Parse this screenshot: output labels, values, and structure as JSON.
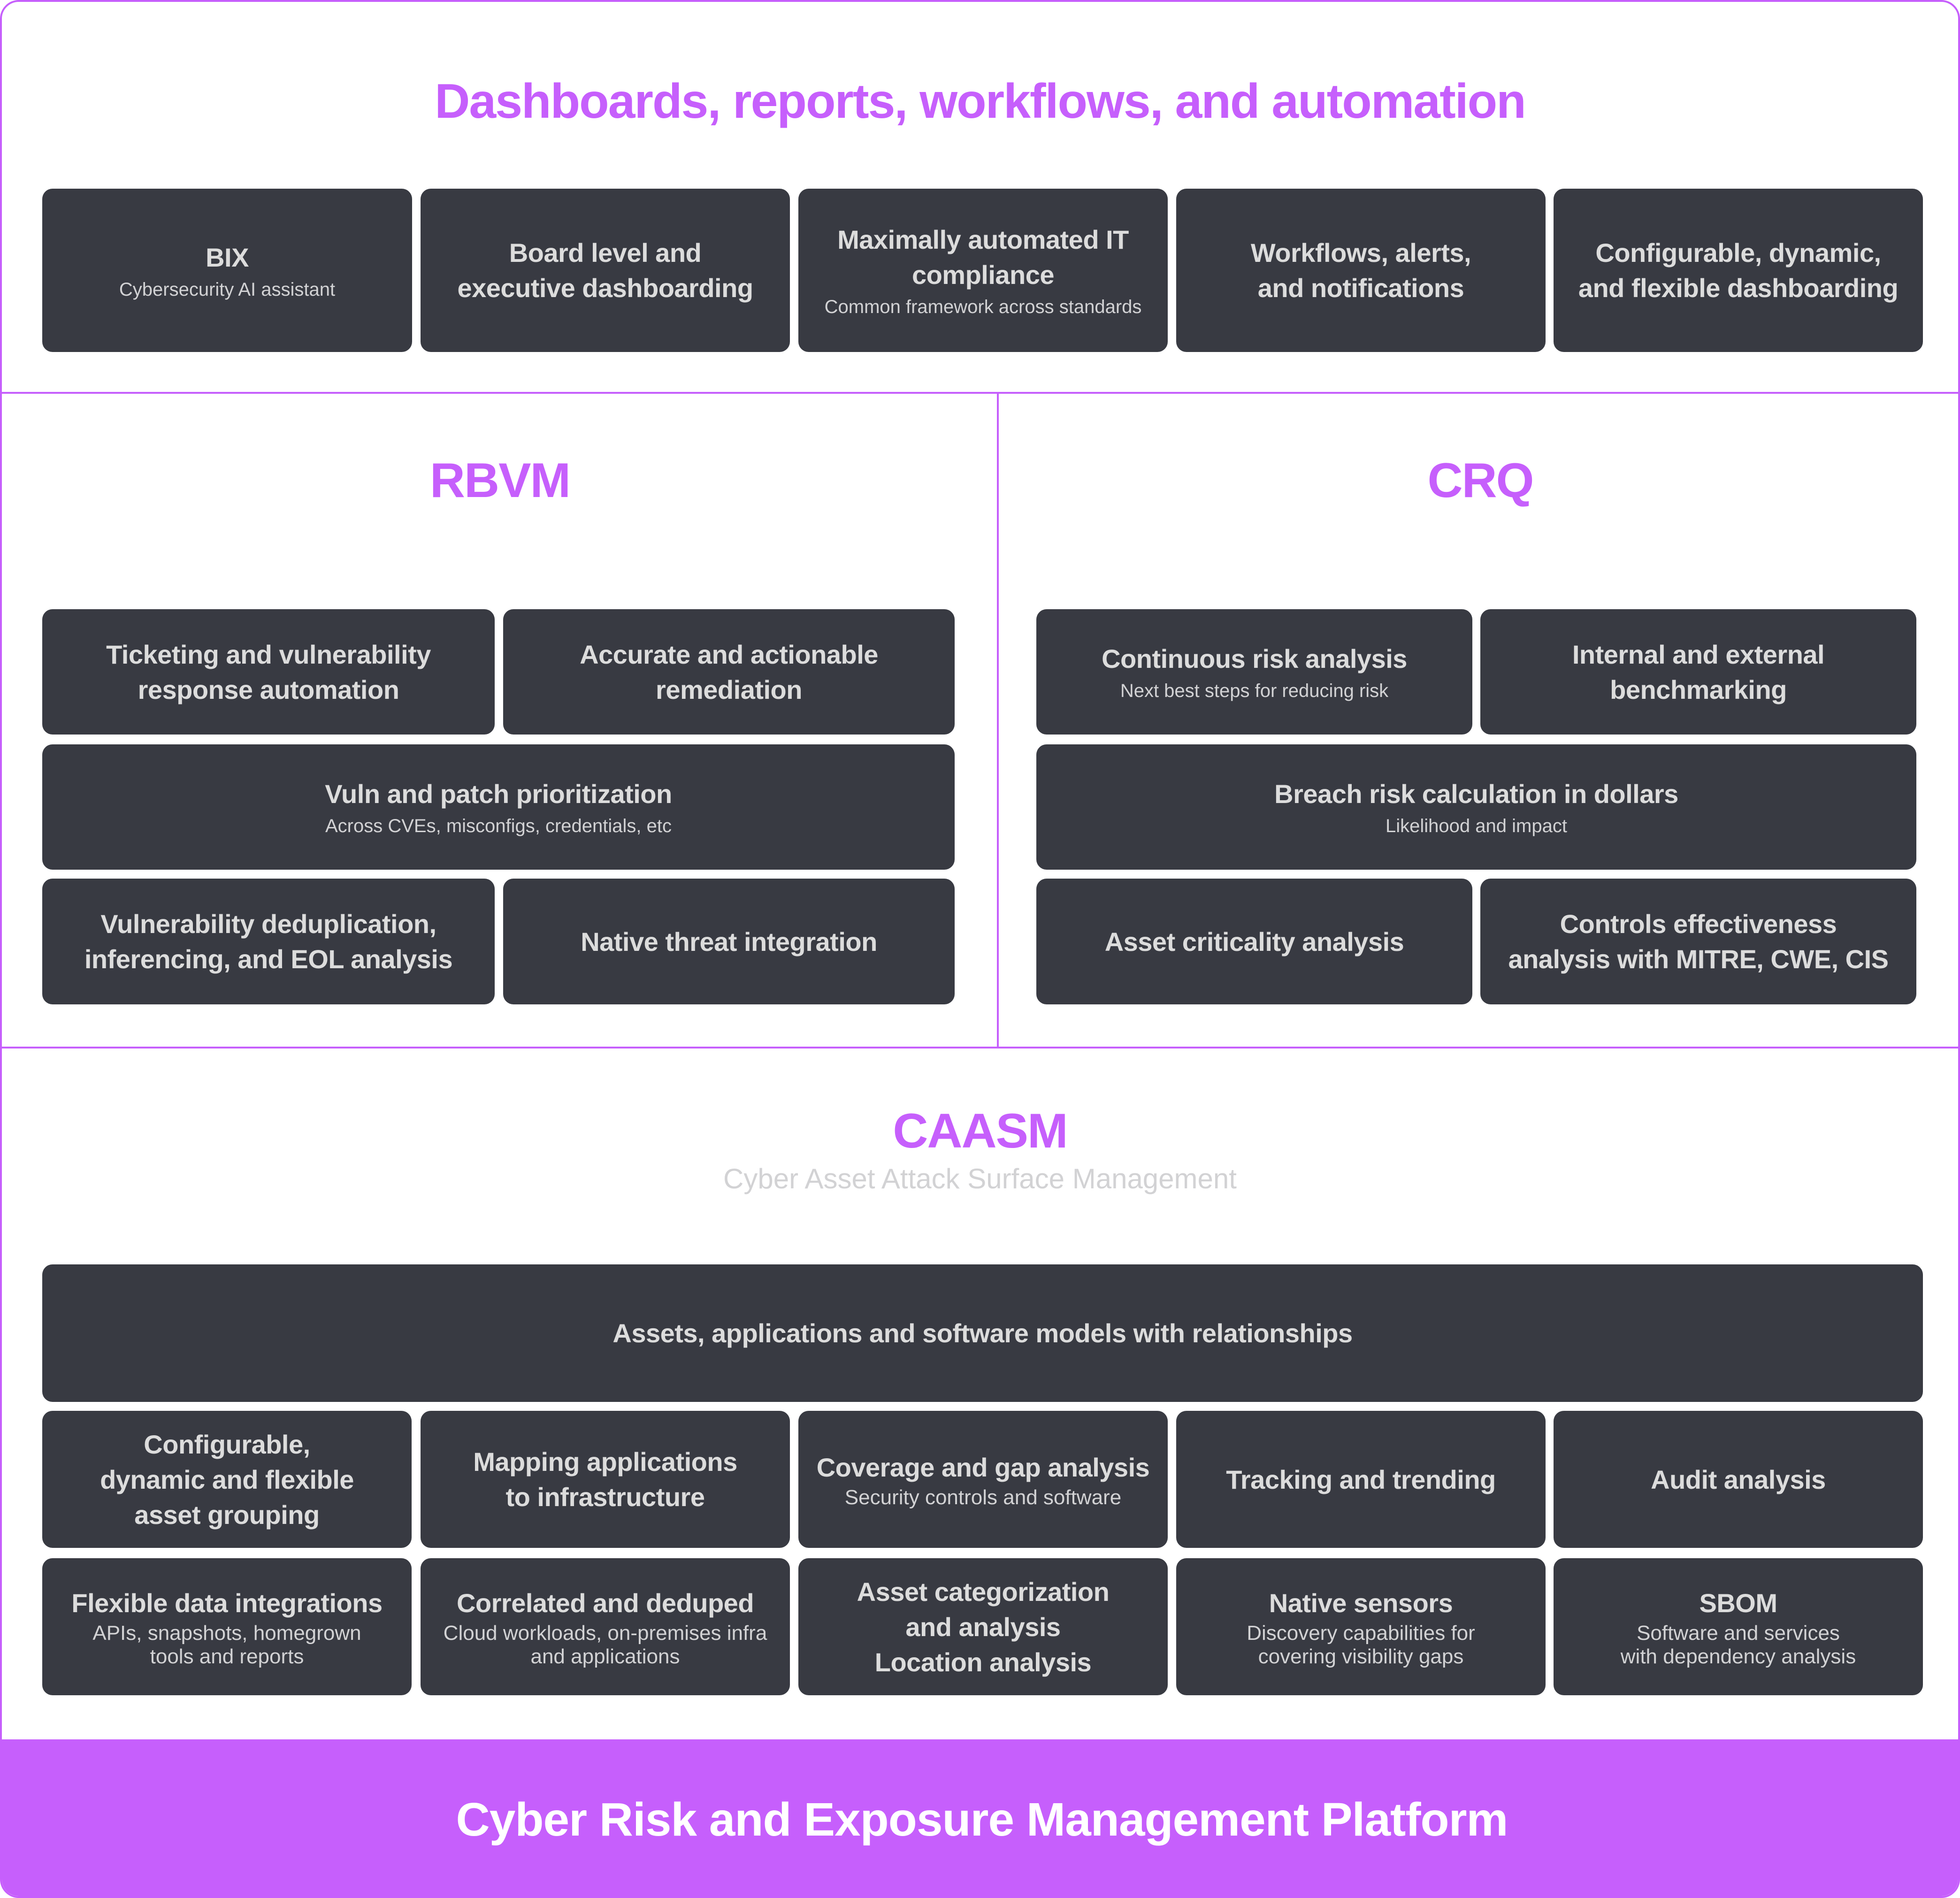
{
  "colors": {
    "accent": "#c65ffc",
    "card_bg": "#383a42",
    "card_text": "#dcdcdc",
    "subtitle_gray": "#d2d2d4"
  },
  "top": {
    "title": "Dashboards, reports, workflows, and automation",
    "cards": [
      {
        "title": "BIX",
        "subtitle": "Cybersecurity AI assistant"
      },
      {
        "title": "Board level and\nexecutive dashboarding",
        "subtitle": ""
      },
      {
        "title": "Maximally automated IT\ncompliance",
        "subtitle": "Common framework across standards"
      },
      {
        "title": "Workflows, alerts,\nand notifications",
        "subtitle": ""
      },
      {
        "title": "Configurable, dynamic,\nand flexible dashboarding",
        "subtitle": ""
      }
    ]
  },
  "rbvm": {
    "title": "RBVM",
    "cards": [
      {
        "title": "Ticketing and vulnerability\nresponse automation",
        "subtitle": ""
      },
      {
        "title": "Accurate and actionable\nremediation",
        "subtitle": ""
      },
      {
        "title": "Vuln and patch prioritization",
        "subtitle": "Across CVEs, misconfigs, credentials, etc"
      },
      {
        "title": "Vulnerability deduplication,\ninferencing, and EOL analysis",
        "subtitle": ""
      },
      {
        "title": "Native threat integration",
        "subtitle": ""
      }
    ]
  },
  "crq": {
    "title": "CRQ",
    "cards": [
      {
        "title": "Continuous risk analysis",
        "subtitle": "Next best steps for reducing risk"
      },
      {
        "title": "Internal and external\nbenchmarking",
        "subtitle": ""
      },
      {
        "title": "Breach risk calculation in dollars",
        "subtitle": "Likelihood and impact"
      },
      {
        "title": "Asset criticality analysis",
        "subtitle": ""
      },
      {
        "title": "Controls effectiveness\nanalysis with MITRE, CWE, CIS",
        "subtitle": ""
      }
    ]
  },
  "caasm": {
    "title": "CAASM",
    "subtitle": "Cyber Asset Attack Surface Management",
    "wide_card": {
      "title": "Assets, applications and software models with relationships"
    },
    "row1": [
      {
        "title": "Configurable,\ndynamic and flexible\nasset grouping",
        "subtitle": ""
      },
      {
        "title": "Mapping applications\nto infrastructure",
        "subtitle": ""
      },
      {
        "title": "Coverage and gap analysis",
        "subtitle": "Security controls and software"
      },
      {
        "title": "Tracking and trending",
        "subtitle": ""
      },
      {
        "title": "Audit analysis",
        "subtitle": ""
      }
    ],
    "row2": [
      {
        "title": "Flexible data integrations",
        "subtitle": "APIs, snapshots, homegrown\ntools and reports"
      },
      {
        "title": "Correlated and deduped",
        "subtitle": "Cloud workloads, on-premises infra\nand applications"
      },
      {
        "title": "Asset categorization\nand analysis\nLocation analysis",
        "subtitle": ""
      },
      {
        "title": "Native sensors",
        "subtitle": "Discovery capabilities for\ncovering visibility gaps"
      },
      {
        "title": "SBOM",
        "subtitle": "Software and services\nwith dependency analysis"
      }
    ]
  },
  "footer": {
    "title": "Cyber Risk and Exposure Management Platform"
  }
}
